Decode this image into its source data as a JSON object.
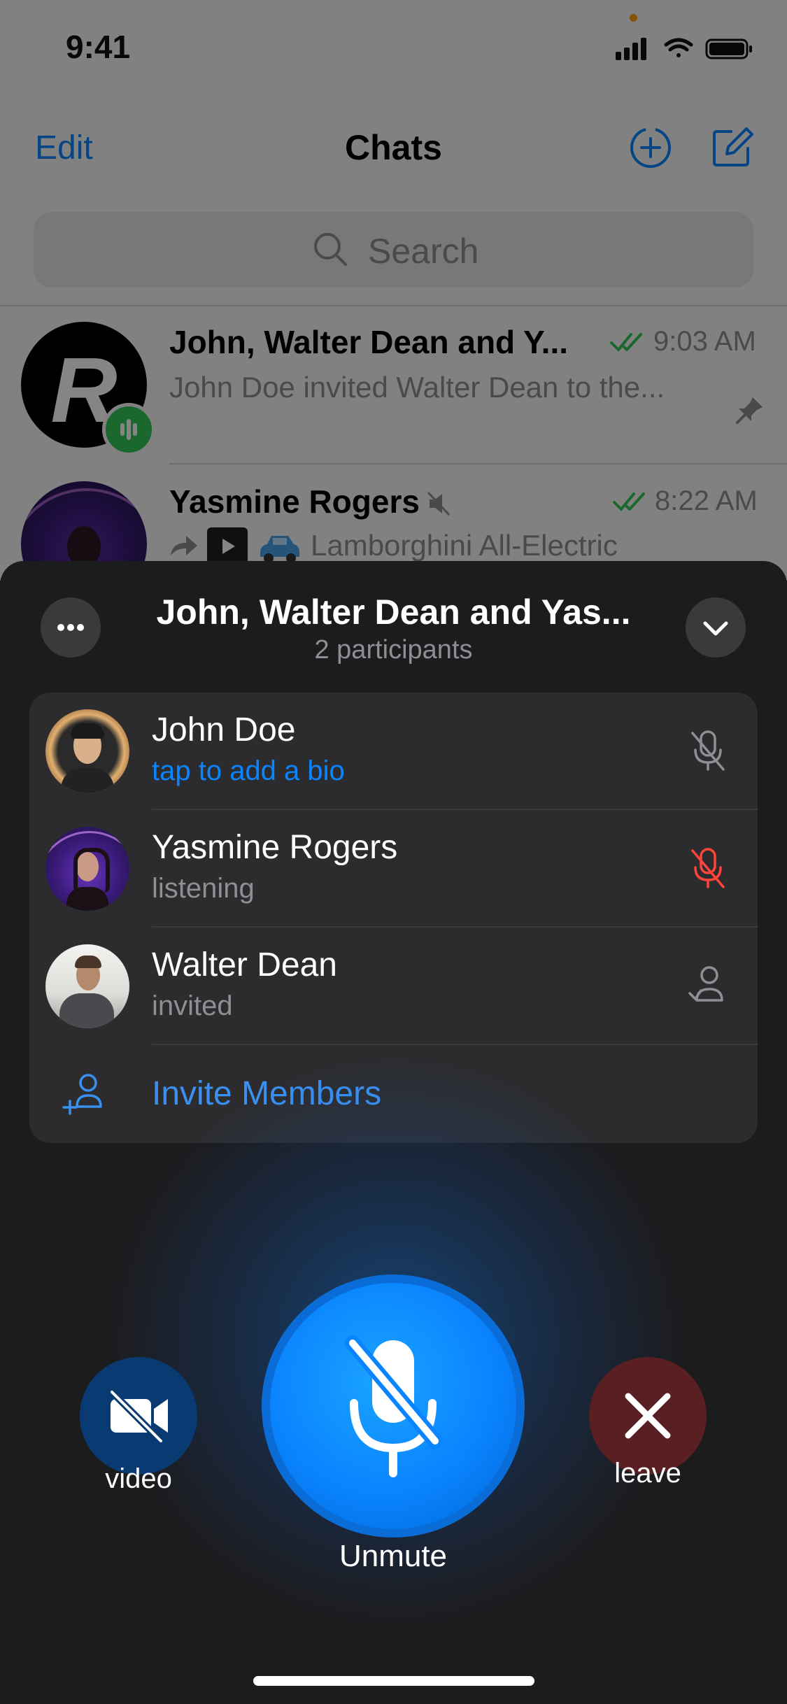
{
  "status_bar": {
    "time": "9:41"
  },
  "nav": {
    "edit_label": "Edit",
    "title": "Chats"
  },
  "search": {
    "placeholder": "Search"
  },
  "chats": [
    {
      "name": "John, Walter Dean and Y...",
      "message": "John Doe invited Walter Dean to the...",
      "time": "9:03 AM",
      "avatar_letter": "R"
    },
    {
      "name": "Yasmine Rogers",
      "message": "Lamborghini All-Electric",
      "time": "8:22 AM"
    }
  ],
  "call": {
    "title": "John, Walter Dean and Yas...",
    "subtitle": "2 participants",
    "participants": [
      {
        "name": "John Doe",
        "status": "tap to add a bio",
        "icon": "mic-muted-icon"
      },
      {
        "name": "Yasmine Rogers",
        "status": "listening",
        "icon": "mic-muted-red-icon"
      },
      {
        "name": "Walter Dean",
        "status": "invited",
        "icon": "invited-person-icon"
      }
    ],
    "invite_label": "Invite Members",
    "buttons": {
      "video": "video",
      "unmute": "Unmute",
      "leave": "leave"
    }
  },
  "colors": {
    "accent": "#0a84ff",
    "muted_red": "#ff453a",
    "online_green": "#34c759",
    "panel_bg": "#1c1c1e",
    "list_bg": "#2c2c2e"
  }
}
